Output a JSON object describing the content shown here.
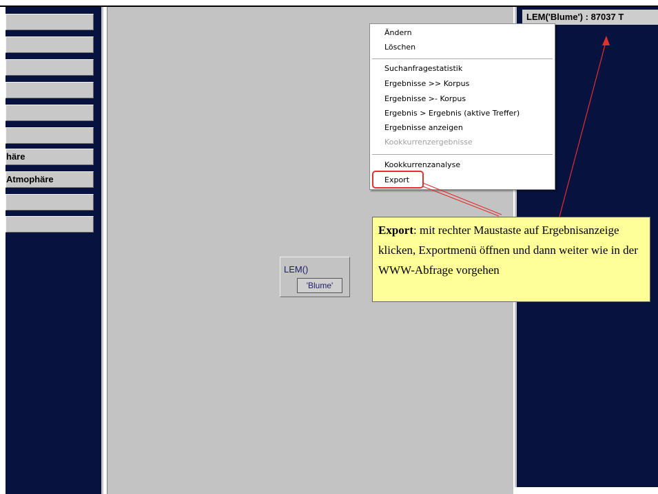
{
  "left_sidebar": {
    "items": [
      {
        "label": ""
      },
      {
        "label": ""
      },
      {
        "label": ""
      },
      {
        "label": ""
      },
      {
        "label": ""
      },
      {
        "label": ""
      },
      {
        "label": "häre"
      },
      {
        "label": "Atmophäre"
      },
      {
        "label": ""
      },
      {
        "label": ""
      }
    ]
  },
  "right_panel": {
    "title": "LEM('Blume') : 87037 T"
  },
  "query": {
    "label": "LEM()",
    "argument": "'Blume'"
  },
  "context_menu": {
    "group1": [
      "Ändern",
      "Löschen"
    ],
    "group2": [
      "Suchanfragestatistik",
      "Ergebnisse >> Korpus",
      "Ergebnisse >- Korpus",
      "Ergebnis > Ergebnis (aktive Treffer)",
      "Ergebnisse anzeigen",
      "Kookkurrenzergebnisse"
    ],
    "group3": [
      "Kookkurrenzanalyse",
      "Export"
    ],
    "disabled_item": "Kookkurrenzergebnisse"
  },
  "callout": {
    "title": "Export",
    "text": ": mit rechter Maustaste auf Ergebnisanzeige klicken, Exportmenü öffnen und dann weiter wie in der WWW-Abfrage vorgehen"
  },
  "colors": {
    "panel_dark": "#08123e",
    "panel_gray": "#c3c3c3",
    "callout_bg": "#ffff99",
    "annotation_red": "#e03030"
  }
}
